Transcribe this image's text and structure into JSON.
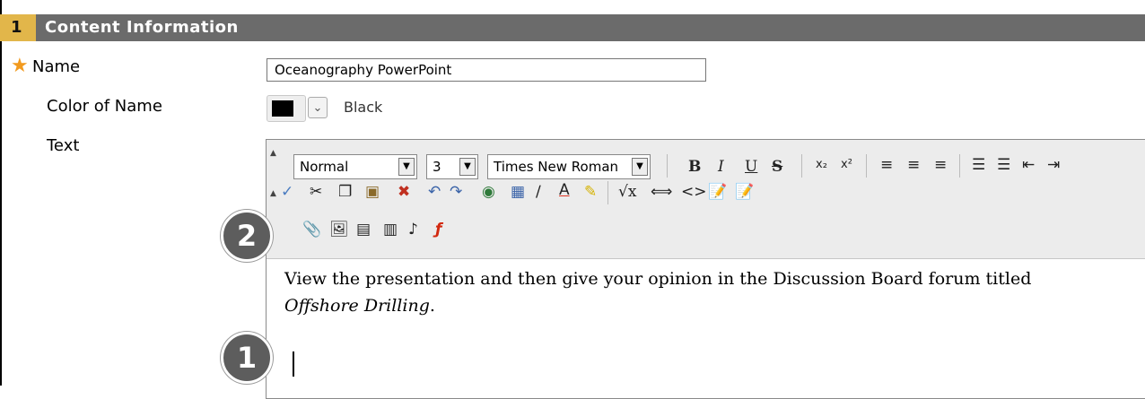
{
  "section": {
    "number": "1",
    "title": "Content Information"
  },
  "fields": {
    "name_label": "Name",
    "name_value": "Oceanography PowerPoint",
    "color_label": "Color of Name",
    "color_value": "Black",
    "text_label": "Text"
  },
  "toolbar": {
    "format_select": "Normal",
    "size_select": "3",
    "font_select": "Times New Roman",
    "bold": "B",
    "italic": "I",
    "underline": "U",
    "strike": "S"
  },
  "editor_content": {
    "line1": "View the presentation and then give your opinion in the Discussion Board forum titled",
    "italic_phrase": "Offshore Drilling",
    "period": "."
  },
  "callouts": {
    "one": "1",
    "two": "2"
  },
  "colors": {
    "header_bg": "#6b6b6b",
    "step_badge": "#e2b64a",
    "required_star": "#f29a1e"
  }
}
